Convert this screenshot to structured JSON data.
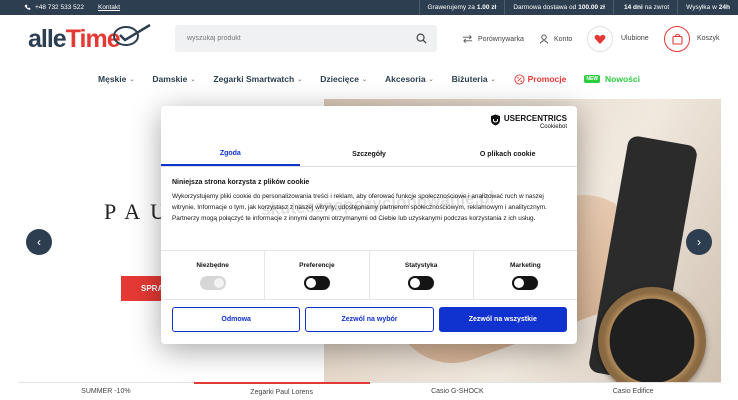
{
  "topbar": {
    "phone": "+48 732 533 522",
    "contact": "Kontakt",
    "engraving_pre": "Grawerujemy za",
    "engraving_price": "1.00 zł",
    "shipping_pre": "Darmowa dostawa od",
    "shipping_price": "100.00 zł",
    "returns_days": "14 dni",
    "returns_post": "na zwrot",
    "dispatch_pre": "Wysyłka w",
    "dispatch_time": "24h"
  },
  "header": {
    "logo_part1": "alle",
    "logo_part2": "Time",
    "search_placeholder": "wyszukaj produkt",
    "compare": "Porównywarka",
    "account": "Konto",
    "favorites": "Ulubione",
    "cart": "Koszyk"
  },
  "nav": {
    "items": [
      "Męskie",
      "Damskie",
      "Zegarki Smartwatch",
      "Dziecięce",
      "Akcesoria",
      "Biżuteria"
    ],
    "promo": "Promocje",
    "new_badge": "NEW",
    "new": "Nowości"
  },
  "hero": {
    "brand": "PAUL",
    "cta": "SPRA"
  },
  "tabs": [
    "SUMMER -10%",
    "Zegarki Paul Lorens",
    "Casio G-SHOCK",
    "Casio Edifice"
  ],
  "consent": {
    "brand": "USERCENTRICS",
    "brand_sub": "Cookiebot",
    "tabs": [
      "Zgoda",
      "Szczegóły",
      "O plikach cookie"
    ],
    "heading": "Niniejsza strona korzysta z plików cookie",
    "body": "Wykorzystujemy pliki cookie do personalizowania treści i reklam, aby oferować funkcje społecznościowe i analizować ruch w naszej witrynie. Informacje o tym, jak korzystasz z naszej witryny, udostępniamy partnerom społecznościowym, reklamowym i analitycznym. Partnerzy mogą połączyć te informacje z innymi danymi otrzymanymi od Ciebie lub uzyskanymi podczas korzystania z ich usług.",
    "toggles": [
      "Niezbędne",
      "Preferencje",
      "Statystyka",
      "Marketing"
    ],
    "deny": "Odmowa",
    "allow_selection": "Zezwól na wybór",
    "allow_all": "Zezwól na wszystkie",
    "watermark": "skutecznepozycjonowanie.pl"
  },
  "colors": {
    "accent": "#e53935",
    "dark": "#2c3e50",
    "consent_blue": "#1032cf"
  }
}
